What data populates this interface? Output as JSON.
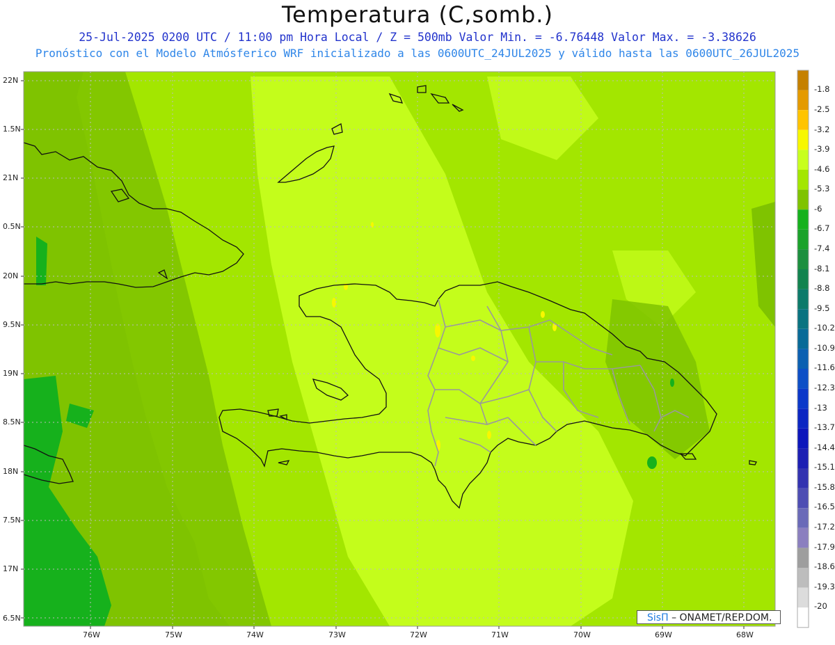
{
  "header": {
    "title": "Temperatura (C,somb.)",
    "line1": "25-Jul-2025  0200 UTC / 11:00 pm Hora Local / Z = 500mb  Valor Min. = -6.76448  Valor Max. = -3.38626",
    "line2": "Pronóstico con el Modelo Atmósferico WRF inicializado a las 0600UTC_24JUL2025 y válido hasta las  0600UTC_26JUL2025"
  },
  "axes": {
    "lat_ticks": [
      "22N",
      "1.5N",
      "21N",
      "0.5N",
      "20N",
      "9.5N",
      "19N",
      "8.5N",
      "18N",
      "7.5N",
      "17N",
      "6.5N"
    ],
    "lon_ticks": [
      "76W",
      "75W",
      "74W",
      "73W",
      "72W",
      "71W",
      "70W",
      "69W",
      "68W"
    ]
  },
  "colorbar": {
    "labels": [
      "-1.8",
      "-2.5",
      "-3.2",
      "-3.9",
      "-4.6",
      "-5.3",
      "-6",
      "-6.7",
      "-7.4",
      "-8.1",
      "-8.8",
      "-9.5",
      "-10.2",
      "-10.9",
      "-11.6",
      "-12.3",
      "-13",
      "-13.7",
      "-14.4",
      "-15.1",
      "-15.8",
      "-16.5",
      "-17.2",
      "-17.9",
      "-18.6",
      "-19.3",
      "-20"
    ],
    "colors": [
      "#c58000",
      "#e49a00",
      "#ffc400",
      "#f7f700",
      "#c8ff1e",
      "#a3e600",
      "#7fc300",
      "#16b11c",
      "#1ba22a",
      "#1c8f3e",
      "#12834f",
      "#0c7a6a",
      "#097380",
      "#086a97",
      "#0b60b1",
      "#0d4fc6",
      "#0b38c9",
      "#0b26c2",
      "#0c16bb",
      "#1c1fb3",
      "#3232b0",
      "#4d4db3",
      "#6a6ab8",
      "#8b7fbf",
      "#9e9e9e",
      "#bdbdbd",
      "#dcdcdc",
      "#ffffff"
    ]
  },
  "credit": {
    "brand": "SisΠ",
    "org": "– ONAMET/REP.DOM."
  }
}
